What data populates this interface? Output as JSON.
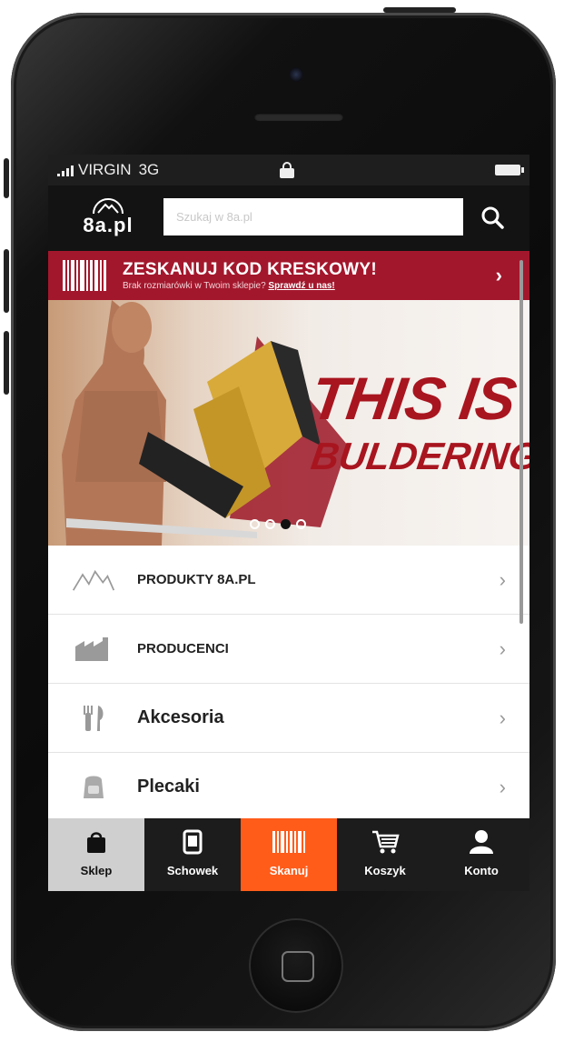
{
  "status_bar": {
    "carrier": "VIRGIN",
    "network": "3G"
  },
  "header": {
    "logo_text": "8a.pl",
    "search_placeholder": "Szukaj w 8a.pl"
  },
  "scan_banner": {
    "title": "ZESKANUJ KOD KRESKOWY!",
    "subtitle": "Brak rozmiarówki w Twoim sklepie?",
    "subtitle_link": "Sprawdź u nas!",
    "arrow": "›"
  },
  "hero": {
    "title": "THIS IS",
    "subtitle": "BULDERING",
    "slides_total": 4,
    "active_slide": 3
  },
  "menu": {
    "items": [
      {
        "label": "PRODUKTY 8A.PL",
        "icon": "mountains-icon"
      },
      {
        "label": "PRODUCENCI",
        "icon": "factory-icon"
      },
      {
        "label": "Akcesoria",
        "icon": "cutlery-icon"
      },
      {
        "label": "Plecaki",
        "icon": "backpack-icon"
      }
    ],
    "chevron": "›"
  },
  "tabbar": {
    "tabs": [
      {
        "label": "Sklep",
        "icon": "bag-icon",
        "selected": true
      },
      {
        "label": "Schowek",
        "icon": "phone-icon"
      },
      {
        "label": "Skanuj",
        "icon": "barcode-icon",
        "highlight": true
      },
      {
        "label": "Koszyk",
        "icon": "cart-icon"
      },
      {
        "label": "Konto",
        "icon": "person-icon"
      }
    ]
  },
  "colors": {
    "banner_red": "#a3172c",
    "scan_orange": "#ff5c1a",
    "header_dark": "#131313",
    "tab_selected": "#cfcfcf"
  }
}
